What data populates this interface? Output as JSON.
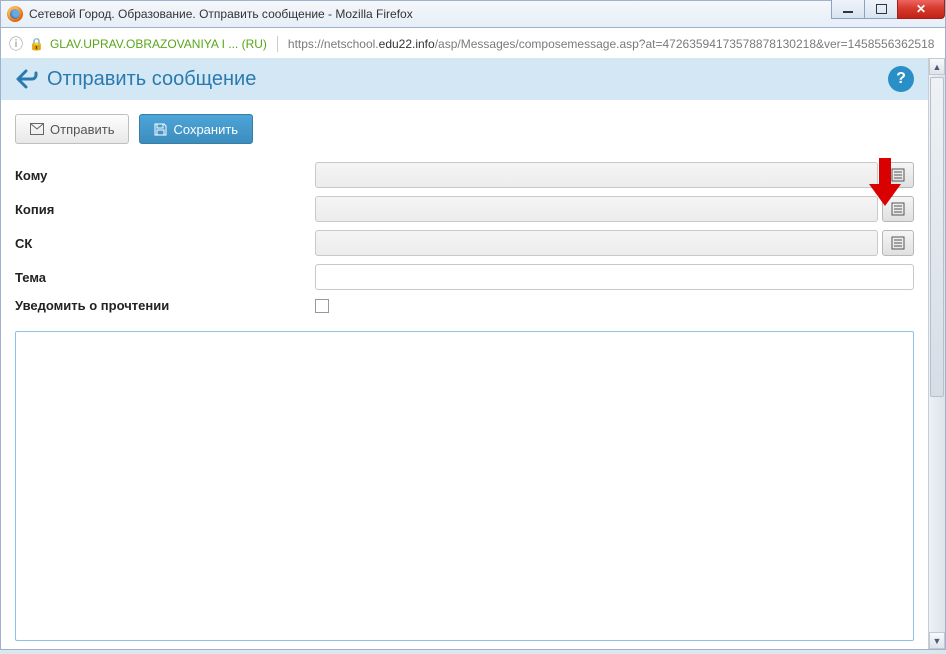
{
  "window": {
    "title": "Сетевой Город. Образование. Отправить сообщение - Mozilla Firefox"
  },
  "addressbar": {
    "identity": "GLAV.UPRAV.OBRAZOVANIYA I ... (RU)",
    "url_prefix": "https://netschool.",
    "url_domain": "edu22.info",
    "url_path": "/asp/Messages/composemessage.asp?at=47263594173578878130218&ver=1458556362518"
  },
  "header": {
    "title": "Отправить сообщение",
    "help_tooltip": "?"
  },
  "toolbar": {
    "send_label": "Отправить",
    "save_label": "Сохранить"
  },
  "form": {
    "to_label": "Кому",
    "copy_label": "Копия",
    "bcc_label": "СК",
    "subject_label": "Тема",
    "read_receipt_label": "Уведомить о прочтении",
    "to_value": "",
    "copy_value": "",
    "bcc_value": "",
    "subject_value": "",
    "read_receipt_checked": false
  }
}
